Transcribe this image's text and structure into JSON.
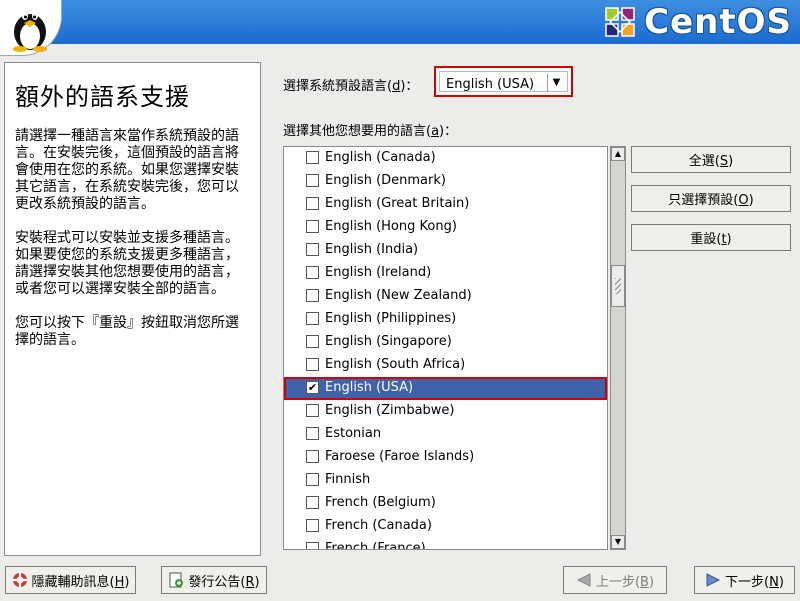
{
  "header": {
    "brand": "CentOS"
  },
  "help": {
    "title": "額外的語系支援",
    "paragraphs": [
      "請選擇一種語言來當作系統預設的語言。在安裝完後，這個預設的語言將會使用在您的系統。如果您選擇安裝其它語言，在系統安裝完後，您可以更改系統預設的語言。",
      "安裝程式可以安裝並支援多種語言。如果要使您的系統支援更多種語言，請選擇安裝其他您想要使用的語言，或者您可以選擇安裝全部的語言。",
      "您可以按下『重設』按鈕取消您所選擇的語言。"
    ]
  },
  "default_language": {
    "label_before": "選擇系統預設語言(",
    "label_key": "d",
    "label_after": ")：",
    "value": "English (USA)"
  },
  "other_languages": {
    "label_before": "選擇其他您想要用的語言(",
    "label_key": "a",
    "label_after": ")：",
    "items": [
      {
        "label": "English (Canada)",
        "checked": false
      },
      {
        "label": "English (Denmark)",
        "checked": false
      },
      {
        "label": "English (Great Britain)",
        "checked": false
      },
      {
        "label": "English (Hong Kong)",
        "checked": false
      },
      {
        "label": "English (India)",
        "checked": false
      },
      {
        "label": "English (Ireland)",
        "checked": false
      },
      {
        "label": "English (New Zealand)",
        "checked": false
      },
      {
        "label": "English (Philippines)",
        "checked": false
      },
      {
        "label": "English (Singapore)",
        "checked": false
      },
      {
        "label": "English (South Africa)",
        "checked": false
      },
      {
        "label": "English (USA)",
        "checked": true,
        "selected": true
      },
      {
        "label": "English (Zimbabwe)",
        "checked": false
      },
      {
        "label": "Estonian",
        "checked": false
      },
      {
        "label": "Faroese (Faroe Islands)",
        "checked": false
      },
      {
        "label": "Finnish",
        "checked": false
      },
      {
        "label": "French (Belgium)",
        "checked": false
      },
      {
        "label": "French (Canada)",
        "checked": false
      },
      {
        "label": "French (France)",
        "checked": false
      }
    ]
  },
  "buttons": {
    "select_all": {
      "before": "全選(",
      "key": "S",
      "after": ")"
    },
    "default_only": {
      "before": "只選擇預設(",
      "key": "O",
      "after": ")"
    },
    "reset": {
      "before": "重設(",
      "key": "t",
      "after": ")"
    },
    "hide_help": {
      "before": "隱藏輔助訊息(",
      "key": "H",
      "after": ")"
    },
    "release_notes": {
      "before": "發行公告(",
      "key": "R",
      "after": ")"
    },
    "back": {
      "before": "上一步(",
      "key": "B",
      "after": ")"
    },
    "next": {
      "before": "下一步(",
      "key": "N",
      "after": ")"
    }
  },
  "colors": {
    "header_blue": "#1a6cd0",
    "selection": "#3f62ab",
    "highlight_border": "#d00000"
  }
}
